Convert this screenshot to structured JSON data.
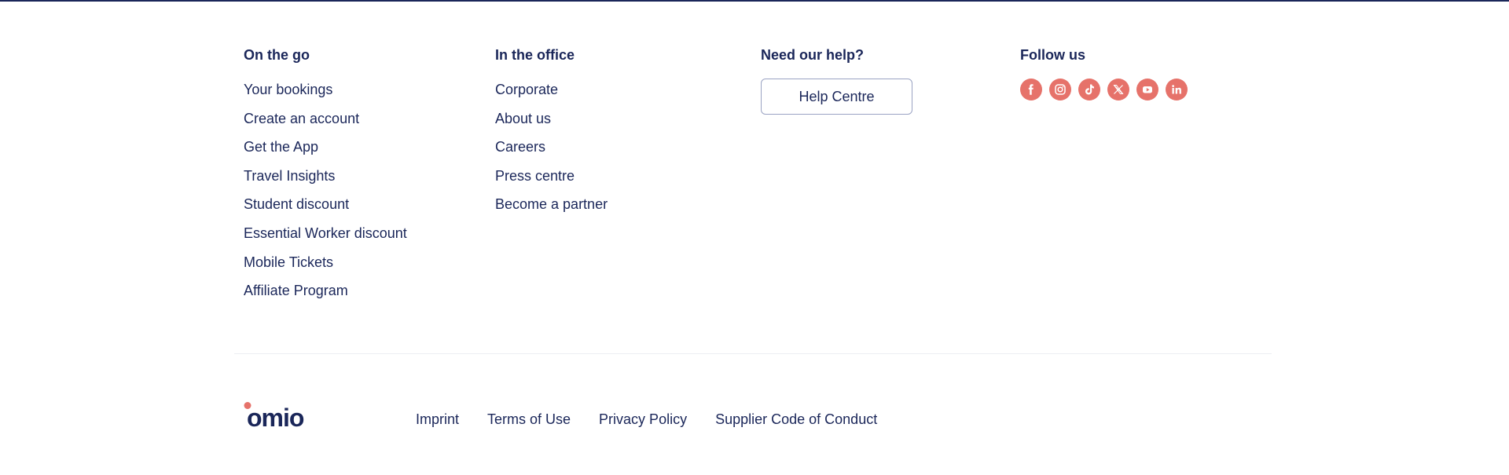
{
  "columns": {
    "on_the_go": {
      "title": "On the go",
      "links": [
        "Your bookings",
        "Create an account",
        "Get the App",
        "Travel Insights",
        "Student discount",
        "Essential Worker discount",
        "Mobile Tickets",
        "Affiliate Program"
      ]
    },
    "in_the_office": {
      "title": "In the office",
      "links": [
        "Corporate",
        "About us",
        "Careers",
        "Press centre",
        "Become a partner"
      ]
    },
    "help": {
      "title": "Need our help?",
      "button_label": "Help Centre"
    },
    "follow": {
      "title": "Follow us",
      "icons": [
        "facebook-icon",
        "instagram-icon",
        "tiktok-icon",
        "x-icon",
        "youtube-icon",
        "linkedin-icon"
      ]
    }
  },
  "footer": {
    "logo_text": "omio",
    "legal_links": [
      "Imprint",
      "Terms of Use",
      "Privacy Policy",
      "Supplier Code of Conduct"
    ]
  },
  "colors": {
    "navy": "#1a2659",
    "accent": "#e6726a",
    "button_border": "#9aa3c3",
    "divider": "#eceef3"
  }
}
